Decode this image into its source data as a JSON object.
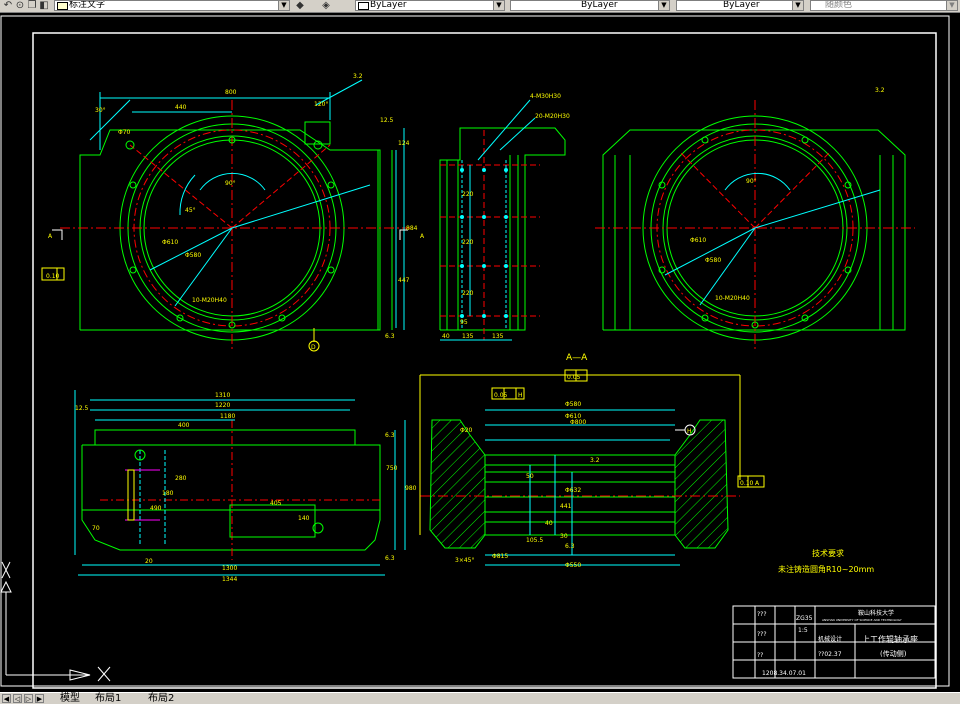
{
  "toolbar": {
    "text_style": "标注文字",
    "layer_color": "ByLayer",
    "linetype": "ByLayer",
    "lineweight": "ByLayer",
    "plot_style": "随颜色"
  },
  "layout_tabs": [
    "模型",
    "布局1",
    "布局2"
  ],
  "drawing": {
    "section_label": "A—A",
    "section_mark": "A",
    "datum_d": "D",
    "datum_h": "H",
    "tolerance_parallel": "0.10",
    "tolerance_runout": "0.05",
    "datum_ref_a": "A",
    "roughness_note": "3.2",
    "dims_top": [
      "800",
      "440",
      "120°",
      "12.5",
      "30°",
      "90°",
      "45°",
      "Φ610",
      "Φ580",
      "10-M20H40",
      "Φ70",
      "124",
      "884",
      "447",
      "6.3"
    ],
    "dims_side": [
      "4-M30H30",
      "20-M20H30",
      "220",
      "220",
      "220",
      "40",
      "135",
      "135",
      "95"
    ],
    "dims_front": [
      "1310",
      "1220",
      "1180",
      "400",
      "405",
      "1300",
      "1344",
      "980",
      "750",
      "490",
      "280",
      "180",
      "140",
      "70",
      "6.3",
      "12.5",
      "20",
      "50"
    ],
    "dims_section": [
      "Φ580",
      "Φ610",
      "Φ632",
      "Φ800",
      "441",
      "Φ20",
      "6.3",
      "3.2",
      "Φ815",
      "Φ550",
      "50",
      "40",
      "30",
      "105.5",
      "3×45°"
    ],
    "tech_title": "技术要求",
    "tech_note": "未注铸造圆角R10~20mm"
  },
  "title_block": {
    "university": "鞍山科技大学",
    "university_en": "ANSHAN UNIVERSITY OF SCIENCE AND TECHNOLOGY",
    "part_name": "上工作辊轴承座",
    "part_sub": "(传动侧)",
    "scale": "1:5",
    "material": "ZG35",
    "class": "机械设计",
    "drawing_no": "??02.37",
    "sheet_no": "1208.34.07.01",
    "design": "???",
    "check": "???",
    "date": "??"
  },
  "colors": {
    "geometry": "#00ff00",
    "center": "#ff0000",
    "dimension": "#00ffff",
    "text": "#ffff00",
    "hatch": "#00ff00",
    "frame": "#ffffff"
  }
}
